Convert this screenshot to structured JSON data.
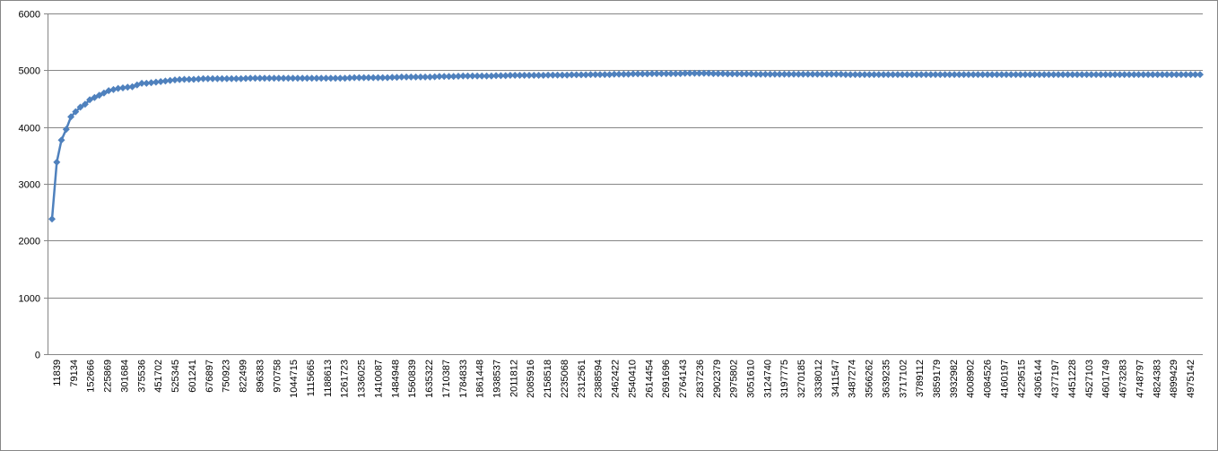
{
  "chart_data": {
    "type": "line",
    "title": "",
    "xlabel": "",
    "ylabel": "",
    "ylim": [
      0,
      6000
    ],
    "yticks": [
      0,
      1000,
      2000,
      3000,
      4000,
      5000,
      6000
    ],
    "grid": "horizontal",
    "legend": "none",
    "colors": {
      "series": "#4F81BD",
      "grid": "#868686",
      "axis": "#868686"
    },
    "x_tick_labels": [
      "11839",
      "79134",
      "152666",
      "225869",
      "301684",
      "375536",
      "451702",
      "525345",
      "601241",
      "676897",
      "750923",
      "822499",
      "896383",
      "970758",
      "1044715",
      "1115665",
      "1188613",
      "1261723",
      "1336025",
      "1410087",
      "1484948",
      "1560839",
      "1635322",
      "1710387",
      "1784833",
      "1861448",
      "1938537",
      "2011812",
      "2085916",
      "2158518",
      "2235068",
      "2312561",
      "2388594",
      "2462422",
      "2540410",
      "2614454",
      "2691696",
      "2764143",
      "2837236",
      "2902379",
      "2975802",
      "3051610",
      "3124740",
      "3197775",
      "3270185",
      "3338012",
      "3411547",
      "3487274",
      "3566262",
      "3639235",
      "3717102",
      "3789112",
      "3859179",
      "3932982",
      "4008902",
      "4084526",
      "4160197",
      "4229515",
      "4306144",
      "4377197",
      "4451228",
      "4527103",
      "4601749",
      "4673283",
      "4748797",
      "4824383",
      "4899429",
      "4975142"
    ],
    "series": [
      {
        "values": [
          2380,
          3380,
          3770,
          3960,
          4180,
          4270,
          4350,
          4400,
          4480,
          4520,
          4560,
          4600,
          4640,
          4660,
          4680,
          4690,
          4700,
          4710,
          4740,
          4770,
          4770,
          4780,
          4790,
          4800,
          4810,
          4820,
          4830,
          4835,
          4840,
          4840,
          4840,
          4845,
          4850,
          4850,
          4850,
          4850,
          4850,
          4850,
          4850,
          4850,
          4850,
          4855,
          4860,
          4860,
          4860,
          4860,
          4860,
          4860,
          4860,
          4860,
          4860,
          4860,
          4860,
          4860,
          4860,
          4860,
          4860,
          4860,
          4860,
          4860,
          4860,
          4860,
          4860,
          4865,
          4870,
          4870,
          4870,
          4870,
          4870,
          4870,
          4870,
          4870,
          4875,
          4875,
          4880,
          4880,
          4880,
          4880,
          4880,
          4880,
          4880,
          4885,
          4890,
          4890,
          4890,
          4890,
          4895,
          4900,
          4900,
          4900,
          4900,
          4900,
          4900,
          4900,
          4905,
          4905,
          4905,
          4910,
          4910,
          4910,
          4910,
          4910,
          4910,
          4910,
          4910,
          4915,
          4915,
          4915,
          4915,
          4915,
          4920,
          4920,
          4920,
          4920,
          4925,
          4925,
          4925,
          4925,
          4925,
          4930,
          4930,
          4930,
          4930,
          4935,
          4935,
          4935,
          4935,
          4940,
          4940,
          4940,
          4940,
          4940,
          4940,
          4940,
          4945,
          4945,
          4945,
          4945,
          4945,
          4945,
          4940,
          4940,
          4940,
          4935,
          4935,
          4935,
          4935,
          4935,
          4935,
          4930,
          4930,
          4930,
          4930,
          4930,
          4930,
          4930,
          4930,
          4930,
          4930,
          4930,
          4930,
          4930,
          4930,
          4930,
          4930,
          4930,
          4930,
          4930,
          4925,
          4925,
          4925,
          4925,
          4925,
          4925,
          4925,
          4925,
          4925,
          4925,
          4925,
          4925,
          4925,
          4925,
          4925,
          4925,
          4925,
          4925,
          4925,
          4925,
          4925,
          4925,
          4925,
          4925,
          4925,
          4925,
          4925,
          4925,
          4925,
          4925,
          4925,
          4925,
          4925,
          4925,
          4925,
          4925,
          4925,
          4925,
          4925,
          4925,
          4925,
          4925,
          4925,
          4925,
          4925,
          4925,
          4925,
          4925,
          4925,
          4925,
          4925,
          4925,
          4925,
          4925,
          4925,
          4925,
          4925,
          4925,
          4925,
          4925,
          4925,
          4925,
          4925,
          4925,
          4925,
          4925,
          4925,
          4925,
          4925,
          4925,
          4925,
          4925,
          4925,
          4925,
          4925,
          4925
        ]
      }
    ]
  }
}
